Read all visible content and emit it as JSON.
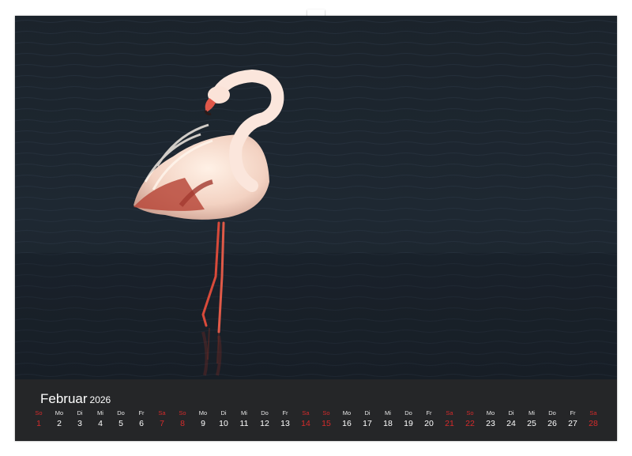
{
  "calendar": {
    "month": "Februar",
    "year": "2026",
    "weekend_color": "#d62b2b",
    "days": [
      {
        "dow": "So",
        "num": "1",
        "red": true
      },
      {
        "dow": "Mo",
        "num": "2",
        "red": false
      },
      {
        "dow": "Di",
        "num": "3",
        "red": false
      },
      {
        "dow": "Mi",
        "num": "4",
        "red": false
      },
      {
        "dow": "Do",
        "num": "5",
        "red": false
      },
      {
        "dow": "Fr",
        "num": "6",
        "red": false
      },
      {
        "dow": "Sa",
        "num": "7",
        "red": true
      },
      {
        "dow": "So",
        "num": "8",
        "red": true
      },
      {
        "dow": "Mo",
        "num": "9",
        "red": false
      },
      {
        "dow": "Di",
        "num": "10",
        "red": false
      },
      {
        "dow": "Mi",
        "num": "11",
        "red": false
      },
      {
        "dow": "Do",
        "num": "12",
        "red": false
      },
      {
        "dow": "Fr",
        "num": "13",
        "red": false
      },
      {
        "dow": "Sa",
        "num": "14",
        "red": true
      },
      {
        "dow": "So",
        "num": "15",
        "red": true
      },
      {
        "dow": "Mo",
        "num": "16",
        "red": false
      },
      {
        "dow": "Di",
        "num": "17",
        "red": false
      },
      {
        "dow": "Mi",
        "num": "18",
        "red": false
      },
      {
        "dow": "Do",
        "num": "19",
        "red": false
      },
      {
        "dow": "Fr",
        "num": "20",
        "red": false
      },
      {
        "dow": "Sa",
        "num": "21",
        "red": true
      },
      {
        "dow": "So",
        "num": "22",
        "red": true
      },
      {
        "dow": "Mo",
        "num": "23",
        "red": false
      },
      {
        "dow": "Di",
        "num": "24",
        "red": false
      },
      {
        "dow": "Mi",
        "num": "25",
        "red": false
      },
      {
        "dow": "Do",
        "num": "26",
        "red": false
      },
      {
        "dow": "Fr",
        "num": "27",
        "red": false
      },
      {
        "dow": "Sa",
        "num": "28",
        "red": true
      }
    ]
  }
}
